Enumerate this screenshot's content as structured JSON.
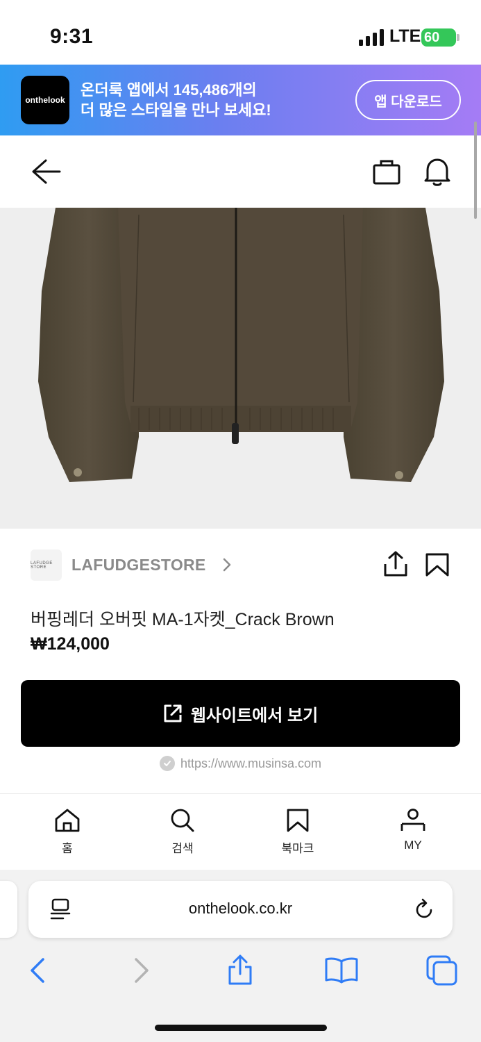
{
  "status_bar": {
    "time": "9:31",
    "carrier": "LTE",
    "battery": "60"
  },
  "promo": {
    "logo_text": "onthelook",
    "line1": "온더룩 앱에서 145,486개의",
    "line2": "더 많은 스타일을 만나 보세요!",
    "button": "앱 다운로드"
  },
  "topnav": {
    "back_icon": "arrow-left-icon",
    "bag_icon": "shopping-bag-icon",
    "bell_icon": "bell-icon"
  },
  "product": {
    "image_alt": "brown zip-up jacket",
    "store_logo_text": "LAFUDGE STORE",
    "store_name": "LAFUDGESTORE",
    "title": "버핑레더 오버핏 MA-1자켓_Crack Brown",
    "price": "₩124,000",
    "website_button": "웹사이트에서 보기",
    "source_url": "https://www.musinsa.com"
  },
  "tabbar": {
    "items": [
      {
        "label": "홈",
        "icon": "home-icon"
      },
      {
        "label": "검색",
        "icon": "search-icon"
      },
      {
        "label": "북마크",
        "icon": "bookmark-icon"
      },
      {
        "label": "MY",
        "icon": "user-icon"
      }
    ]
  },
  "safari": {
    "url": "onthelook.co.kr",
    "accent_color": "#2f7cf6"
  }
}
